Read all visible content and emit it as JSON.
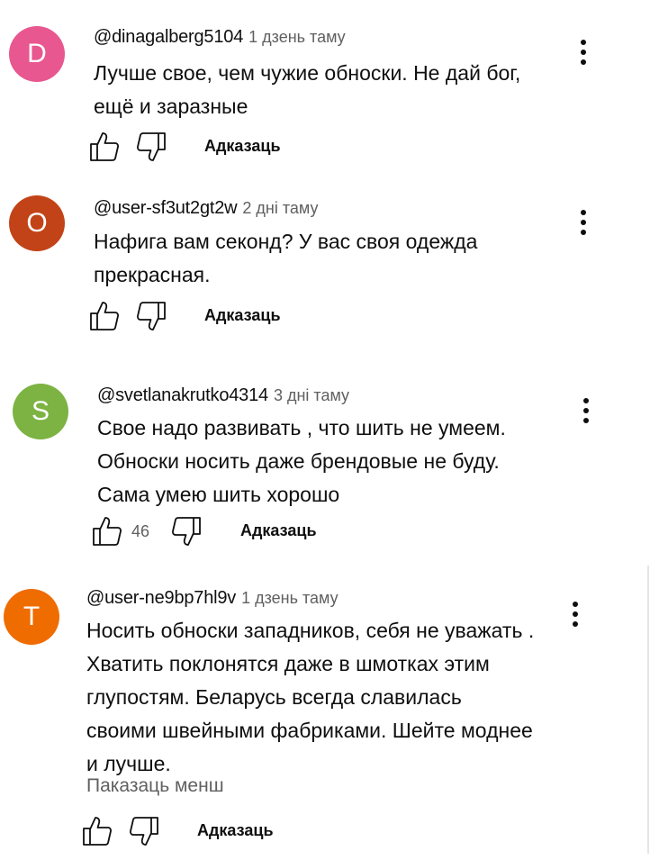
{
  "colors": {
    "avatar_d": "#e8578f",
    "avatar_o": "#c24317",
    "avatar_s": "#7cb342",
    "avatar_t": "#ef6c00",
    "secondary_text": "#606060"
  },
  "comments": [
    {
      "avatar_letter": "D",
      "handle": "@dinagalberg5104",
      "time": "1 дзень таму",
      "lines": [
        "Лучше свое, чем чужие обноски. Не дай бог,",
        "ещё и заразные"
      ],
      "likes": "",
      "reply_label": "Адказаць"
    },
    {
      "avatar_letter": "O",
      "handle": "@user-sf3ut2gt2w",
      "time": "2 дні таму",
      "lines": [
        "Нафига вам секонд? У вас своя одежда",
        "прекрасная."
      ],
      "likes": "",
      "reply_label": "Адказаць"
    },
    {
      "avatar_letter": "S",
      "handle": "@svetlanakrutko4314",
      "time": "3 дні таму",
      "lines": [
        "Свое надо развивать , что шить не умеем.",
        "Обноски носить даже брендовые не буду.",
        "Сама умею шить хорошо"
      ],
      "likes": "46",
      "reply_label": "Адказаць"
    },
    {
      "avatar_letter": "T",
      "handle": "@user-ne9bp7hl9v",
      "time": "1 дзень таму",
      "lines": [
        "Носить обноски западников, себя не уважать .",
        "Хватить поклонятся даже в шмотках этим",
        "глупостям. Беларусь всегда славилась",
        "своими швейными фабриками. Шейте моднее",
        "и лучше."
      ],
      "show_less_label": "Паказаць менш",
      "likes": "",
      "reply_label": "Адказаць"
    }
  ],
  "icons": {
    "like": "thumb-up-icon",
    "dislike": "thumb-down-icon",
    "more": "more-vert-icon"
  }
}
